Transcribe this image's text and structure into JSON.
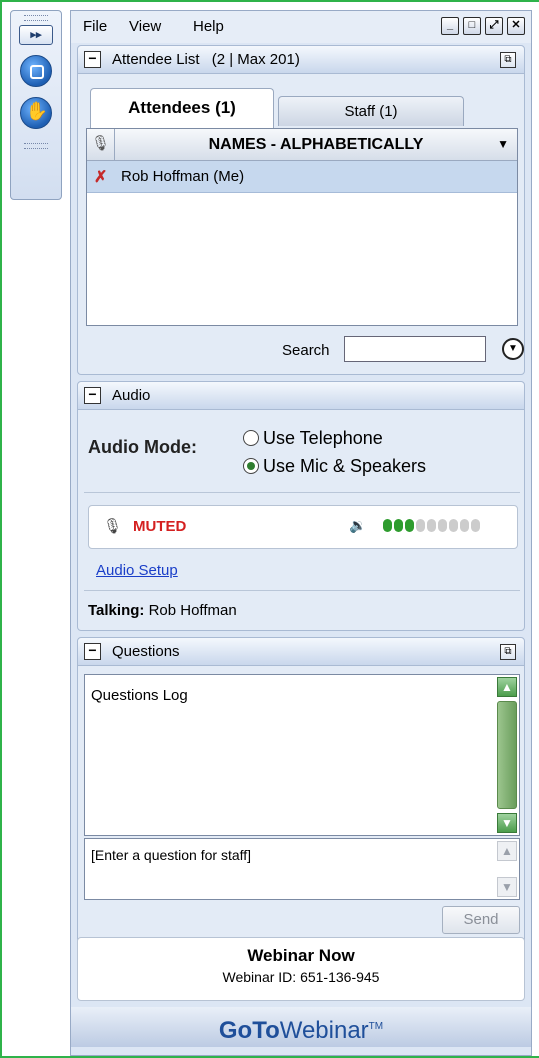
{
  "menu": {
    "file": "File",
    "view": "View",
    "help": "Help"
  },
  "window_buttons": [
    "_",
    "□",
    "⤢",
    "✕"
  ],
  "grabtab": {
    "expand_label": "▸▸"
  },
  "attendee_list": {
    "title": "Attendee List",
    "count": "(2 | Max 201)",
    "tabs": [
      {
        "label": "Attendees (1)",
        "active": true
      },
      {
        "label": "Staff (1)",
        "active": false
      }
    ],
    "column_header": "NAMES - ALPHABETICALLY",
    "rows": [
      {
        "name": "Rob Hoffman (Me)",
        "muted": true
      }
    ],
    "search_label": "Search",
    "search_value": ""
  },
  "audio": {
    "title": "Audio",
    "mode_label": "Audio Mode:",
    "options": [
      {
        "label": "Use Telephone",
        "selected": false
      },
      {
        "label": "Use Mic & Speakers",
        "selected": true
      }
    ],
    "status": "MUTED",
    "volume_level": 0.3,
    "setup_link": "Audio Setup",
    "talking_label": "Talking:",
    "talking_name": "Rob Hoffman"
  },
  "questions": {
    "title": "Questions",
    "log_label": "Questions Log",
    "input_placeholder": "[Enter a question for staff]",
    "send_label": "Send"
  },
  "footer": {
    "webinar_title": "Webinar Now",
    "webinar_id": "Webinar ID: 651-136-945",
    "brand_bold": "GoTo",
    "brand_rest": "Webinar",
    "brand_tm": "TM"
  },
  "colors": {
    "frame": "#2fb34a",
    "muted": "#d42020",
    "link": "#1a3ec8",
    "meter_on": "#2e9c2e",
    "brand": "#1f4f9a"
  }
}
